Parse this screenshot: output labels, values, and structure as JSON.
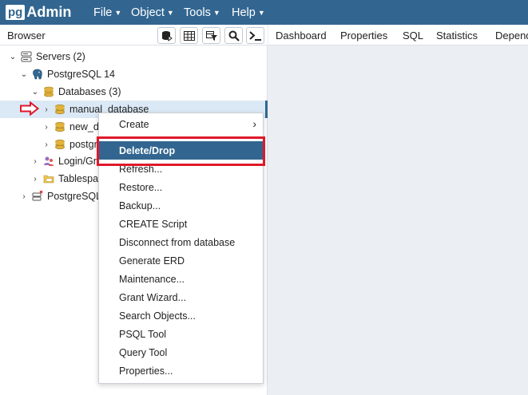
{
  "app": {
    "logo_prefix": "pg",
    "logo_suffix": "Admin",
    "menus": [
      "File",
      "Object",
      "Tools",
      "Help"
    ]
  },
  "browser": {
    "title": "Browser",
    "toolbar_icons": [
      "query-tool-icon",
      "view-data-icon",
      "filtered-rows-icon",
      "search-objects-icon",
      "psql-tool-icon"
    ],
    "tree": [
      {
        "label": "Servers (2)",
        "icon": "servers-icon",
        "expanded": true
      },
      {
        "label": "PostgreSQL 14",
        "icon": "elephant-icon",
        "expanded": true
      },
      {
        "label": "Databases (3)",
        "icon": "databases-icon",
        "expanded": true
      },
      {
        "label": "manual_database",
        "icon": "database-icon",
        "expanded": false,
        "selected": true
      },
      {
        "label": "new_d",
        "icon": "database-icon",
        "expanded": false
      },
      {
        "label": "postgr",
        "icon": "database-icon",
        "expanded": false
      },
      {
        "label": "Login/Gr",
        "icon": "login-roles-icon",
        "expanded": false
      },
      {
        "label": "Tablespa",
        "icon": "tablespaces-icon",
        "expanded": false
      },
      {
        "label": "PostgreSQL",
        "icon": "server-disconnected-icon",
        "expanded": false
      }
    ]
  },
  "tabs": [
    "Dashboard",
    "Properties",
    "SQL",
    "Statistics",
    "Depend"
  ],
  "context_menu": {
    "items": [
      {
        "label": "Create",
        "submenu": true
      },
      {
        "label": "Delete/Drop",
        "active": true
      },
      {
        "label": "Refresh..."
      },
      {
        "label": "Restore..."
      },
      {
        "label": "Backup..."
      },
      {
        "label": "CREATE Script"
      },
      {
        "label": "Disconnect from database"
      },
      {
        "label": "Generate ERD"
      },
      {
        "label": "Maintenance..."
      },
      {
        "label": "Grant Wizard..."
      },
      {
        "label": "Search Objects..."
      },
      {
        "label": "PSQL Tool"
      },
      {
        "label": "Query Tool"
      },
      {
        "label": "Properties..."
      }
    ]
  },
  "colors": {
    "brand": "#326690",
    "highlight_red": "#e0182a",
    "selected_row": "#dbe9f6",
    "db_icon_gold": "#e2b33b"
  }
}
